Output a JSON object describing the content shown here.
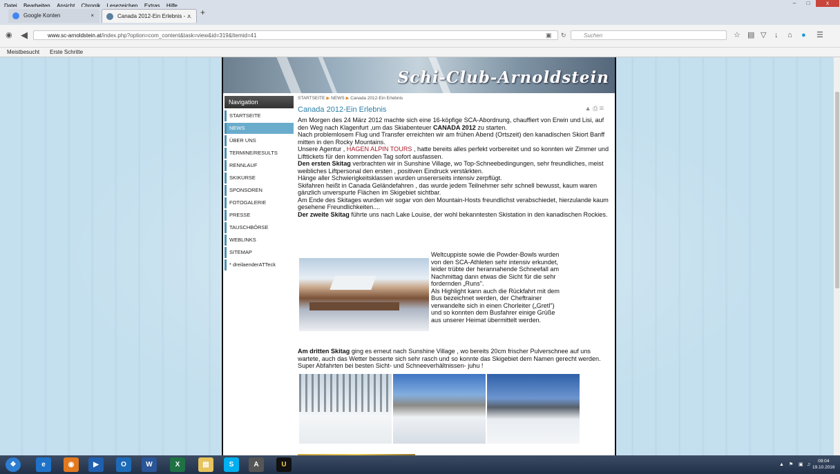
{
  "menubar": {
    "items": [
      "Datei",
      "Bearbeiten",
      "Ansicht",
      "Chronik",
      "Lesezeichen",
      "Extras",
      "Hilfe"
    ]
  },
  "tabs": [
    {
      "label": "Google Konten",
      "close": "×"
    },
    {
      "label": "Canada 2012-Ein Erlebnis - ...",
      "close": "×"
    }
  ],
  "new_tab": "+",
  "window": {
    "min": "–",
    "max": "□",
    "close": "x"
  },
  "url": {
    "host": "www.sc-arnoldstein.at",
    "path": "/index.php?option=com_content&task=view&id=319&Itemid=41"
  },
  "search": {
    "placeholder": "Suchen"
  },
  "bookmarks": [
    "Meistbesucht",
    "Erste Schritte"
  ],
  "site": {
    "title": "Schi-Club-Arnoldstein"
  },
  "navigation": {
    "heading": "Navigation",
    "items": [
      "STARTSEITE",
      "NEWS",
      "ÜBER UNS",
      "TERMINE/RESULTS",
      "RENNLAUF",
      "SKIKURSE",
      "SPONSOREN",
      "FOTOGALERIE",
      "PRESSE",
      "TAUSCHBÖRSE",
      "WEBLINKS",
      "SITEMAP",
      "* dreilaenderATTeck"
    ],
    "active": "NEWS"
  },
  "breadcrumb": {
    "items": [
      "STARTSEITE",
      "NEWS",
      "Canada 2012-Ein Erlebnis"
    ]
  },
  "article": {
    "title": "Canada 2012-Ein Erlebnis",
    "p1_a": "Am Morgen des 24 März 2012 machte sich eine 16-köpfige SCA-Abordnung, chauffiert von Erwin und Lisi, auf den Weg nach Klagenfurt ,um das Skiabenteuer ",
    "p1_b": "CANADA 2012",
    "p1_c": " zu starten.",
    "p2": "Nach problemlosem Flug und Transfer erreichten wir am frühen Abend (Ortszeit) den kanadischen Skiort Banff mitten in den Rocky Mountains.",
    "p3_a": "Unsere Agentur , ",
    "p3_b": "HAGEN ALPIN TOURS",
    "p3_c": " , hatte bereits alles perfekt vorbereitet und so konnten wir Zimmer und Lifttickets für den kommenden Tag sofort ausfassen.",
    "p4_a": "Den ersten Skitag",
    "p4_b": "  verbrachten wir in Sunshine Village, wo Top-Schneebedingungen, sehr freundliches, meist weibliches Liftpersonal den ersten , positiven Eindruck verstärkten.",
    "p5": "Hänge aller Schwierigkeitsklassen wurden unsererseits intensiv zerpflügt.",
    "p6": "Skifahren heißt in Canada Geländefahren , das wurde jedem Teilnehmer sehr schnell bewusst, kaum waren gänzlich unverspurte Flächen  im Skigebiet sichtbar.",
    "p7": "Am Ende des Skitages wurden wir sogar von den Mountain-Hosts freundlichst verabschiedet, hierzulande kaum gesehene Freundlichkeiten....",
    "p8_a": "Der zweite Skitag",
    "p8_b": " führte uns nach Lake Louise, der wohl bekanntesten Skistation in den kanadischen Rockies.",
    "side_lines": [
      "Weltcuppiste sowie die Powder-Bowls wurden",
      "von den SCA-Athleten sehr intensiv erkundet,",
      "leider trübte der herannahende Schneefall am",
      "Nachmittag dann etwas die Sicht für die sehr",
      "fordernden „Runs\".",
      "Als Highlight kann auch die Rückfahrt mit dem",
      "Bus bezeichnet werden, der Cheftrainer",
      "verwandelte sich in einen Chorleiter („Gretl\")",
      "und so konnten dem Busfahrer einige Grüße",
      "aus unserer Heimat übermittelt werden."
    ],
    "p9_a": "Am dritten Skitag",
    "p9_b": " ging es erneut nach Sunshine Village , wo bereits 20cm frischer Pulverschnee auf uns  wartete, auch das Wetter besserte sich sehr rasch und so konnte das Skigebiet dem Namen gerecht werden. Super Abfahrten bei besten Sicht- und Schneeverhältnissen- juhu !"
  },
  "taskbar": {
    "clock_time": "09:04",
    "clock_date": "19.10.2016"
  },
  "colors": {
    "accent": "#2a7ea6",
    "nav_active": "#6aaccc",
    "agency": "#a5182a"
  }
}
